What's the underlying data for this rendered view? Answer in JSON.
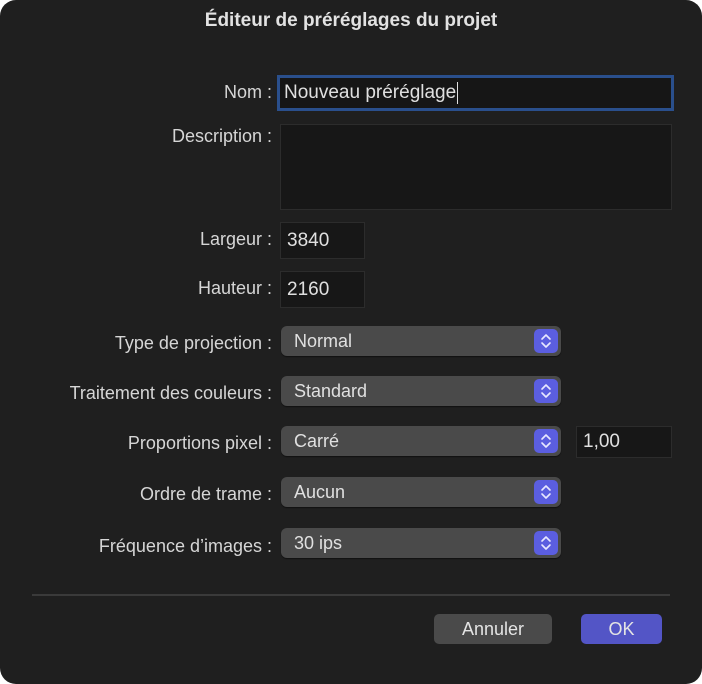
{
  "dialog": {
    "title": "Éditeur de préréglages du projet"
  },
  "form": {
    "name": {
      "label": "Nom :",
      "value": "Nouveau préréglage"
    },
    "description": {
      "label": "Description :",
      "value": ""
    },
    "width": {
      "label": "Largeur :",
      "value": "3840"
    },
    "height": {
      "label": "Hauteur :",
      "value": "2160"
    },
    "projection": {
      "label": "Type de projection :",
      "selected": "Normal"
    },
    "color_processing": {
      "label": "Traitement des couleurs :",
      "selected": "Standard"
    },
    "pixel_aspect": {
      "label": "Proportions pixel :",
      "selected": "Carré",
      "ratio": "1,00"
    },
    "field_order": {
      "label": "Ordre de trame :",
      "selected": "Aucun"
    },
    "frame_rate": {
      "label": "Fréquence d’images :",
      "selected": "30 ips"
    }
  },
  "buttons": {
    "cancel": "Annuler",
    "ok": "OK"
  },
  "colors": {
    "accent": "#5355c6",
    "stepper": "#5b5ee0",
    "focus_ring": "#2a4f8c",
    "background": "#1f1f1f"
  }
}
